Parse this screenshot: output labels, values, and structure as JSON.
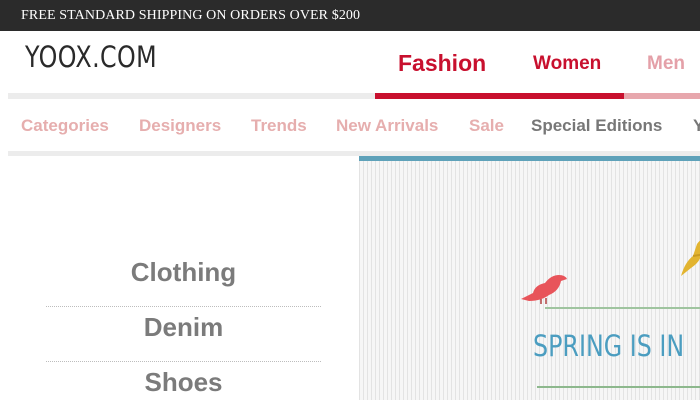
{
  "promo": {
    "text": "FREE STANDARD SHIPPING ON ORDERS OVER $200"
  },
  "logo": {
    "text": "YOOX.COM"
  },
  "main_nav": {
    "tabs": [
      {
        "label": "Fashion",
        "active": true
      },
      {
        "label": "Women"
      },
      {
        "label": "Men"
      }
    ]
  },
  "sub_nav": {
    "items": [
      {
        "label": "Categories"
      },
      {
        "label": "Designers"
      },
      {
        "label": "Trends"
      },
      {
        "label": "New Arrivals"
      },
      {
        "label": "Sale"
      },
      {
        "label": "Special Editions"
      },
      {
        "label": "Y"
      }
    ]
  },
  "categories": {
    "items": [
      {
        "label": "Clothing"
      },
      {
        "label": "Denim"
      },
      {
        "label": "Shoes"
      }
    ]
  },
  "banner": {
    "headline": "SPRING IS IN",
    "icons": [
      "bird-icon",
      "bird-icon"
    ]
  },
  "colors": {
    "brand_red": "#c8102e",
    "promo_bg": "#2b2b2b",
    "subnav_text": "#e6aeae",
    "banner_accent": "#4b9dc0"
  }
}
